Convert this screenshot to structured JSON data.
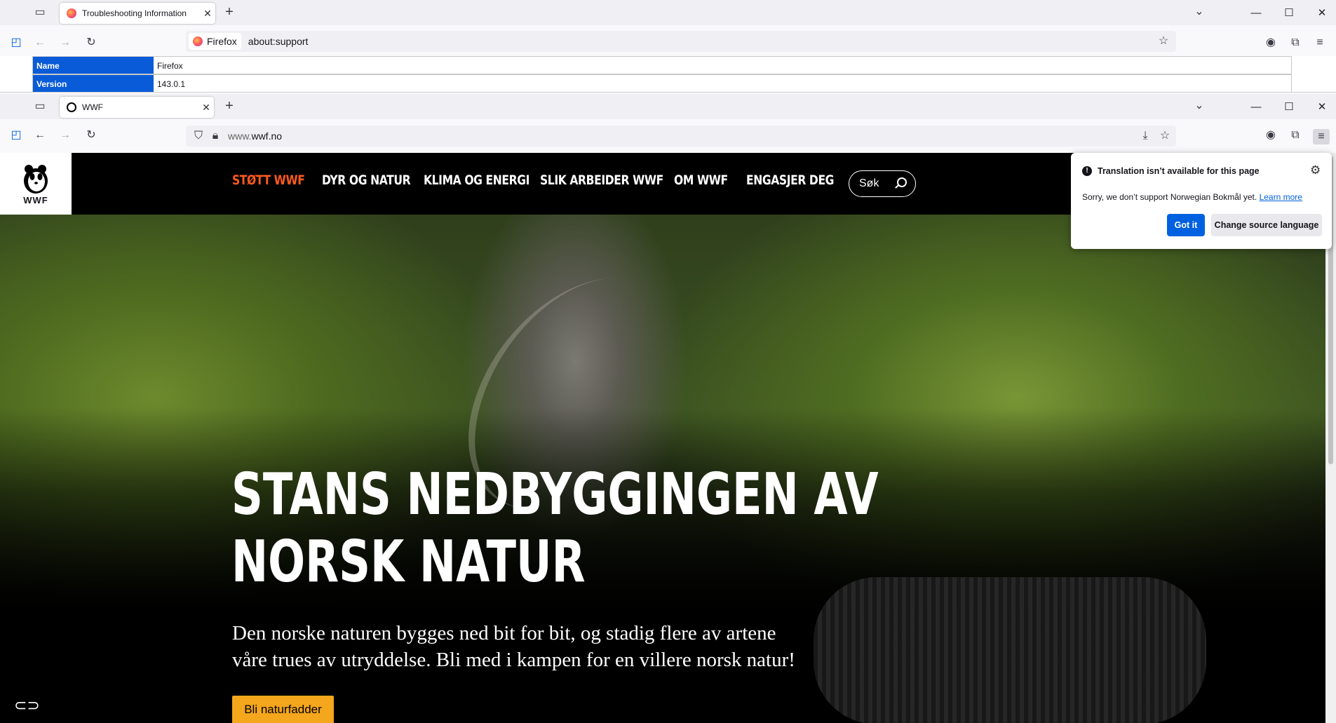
{
  "back_window": {
    "tab_title": "Troubleshooting Information",
    "identity_label": "Firefox",
    "url": "about:support",
    "rows": [
      {
        "key": "Name",
        "value": "Firefox"
      },
      {
        "key": "Version",
        "value": "143.0.1"
      }
    ]
  },
  "front_window": {
    "tab_title": "WWF",
    "url_prefix": "www.",
    "url_domain": "wwf.no"
  },
  "site": {
    "logo_text": "WWF",
    "nav": [
      "STØTT WWF",
      "DYR OG NATUR",
      "KLIMA OG ENERGI",
      "SLIK ARBEIDER WWF",
      "OM WWF",
      "ENGASJER DEG"
    ],
    "nav_active_color": "#ff5a1f",
    "search_label": "Søk",
    "headline_line1": "STANS NEDBYGGINGEN AV",
    "headline_line2": "NORSK NATUR",
    "lead_line1": "Den norske naturen bygges ned bit for bit, og stadig flere av artene",
    "lead_line2": "våre trues av utryddelse. Bli med i kampen for en villere norsk natur!",
    "cta_label": "Bli naturfadder",
    "cta_color": "#f4a61c"
  },
  "translation_popup": {
    "title": "Translation isn’t available for this page",
    "message": "Sorry, we don’t support Norwegian Bokmål yet.",
    "learn_more": "Learn more",
    "got_it": "Got it",
    "change_source": "Change source language"
  },
  "icons": [
    "tab-list-icon",
    "new-tab-icon",
    "sidebar-icon",
    "back-icon",
    "forward-icon",
    "reload-icon",
    "bookmark-star-icon",
    "account-icon",
    "extensions-icon",
    "menu-icon",
    "shield-icon",
    "lock-icon",
    "download-icon",
    "minimize-icon",
    "maximize-icon",
    "close-icon",
    "gear-icon",
    "warning-icon",
    "accessibility-icon"
  ]
}
